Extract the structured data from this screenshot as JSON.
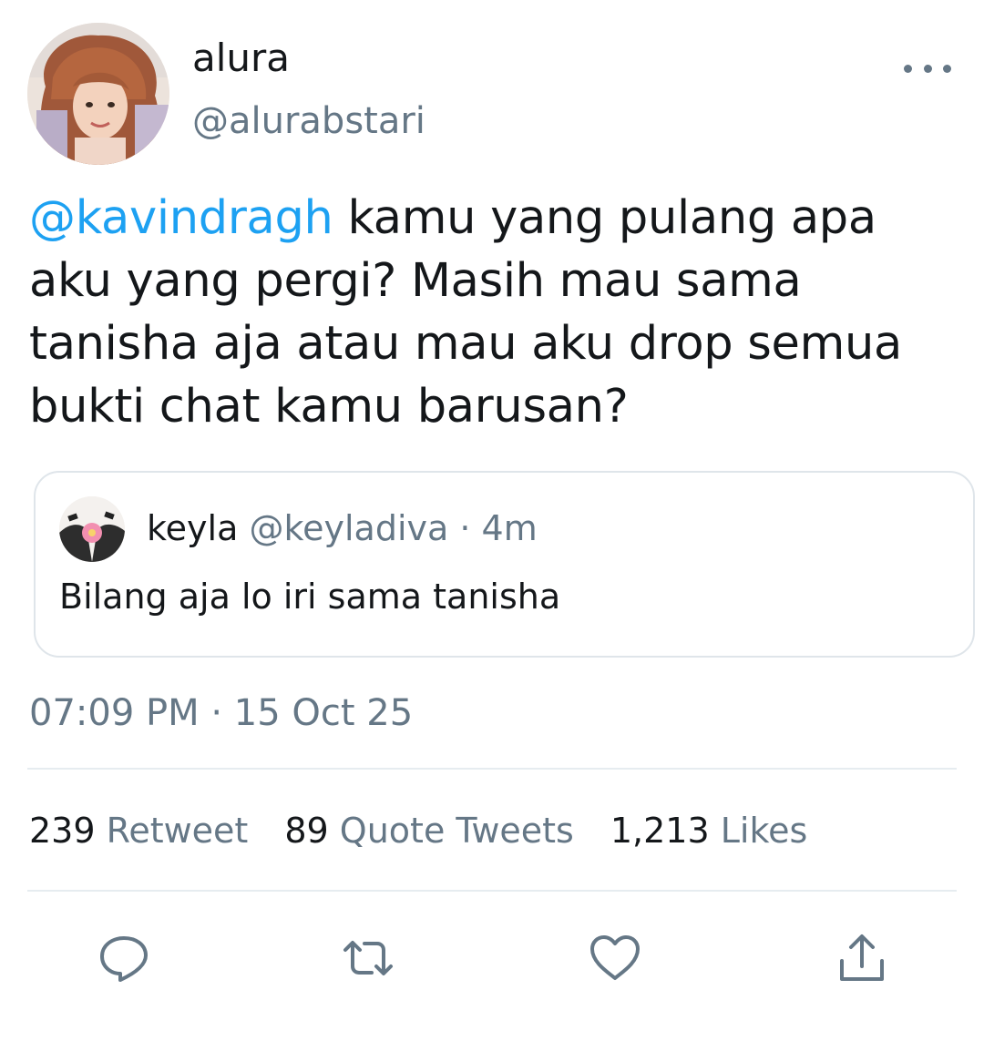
{
  "tweet": {
    "author": {
      "display_name": "alura",
      "handle": "@alurabstari"
    },
    "text": {
      "mention": "@kavindragh",
      "body": " kamu yang pulang apa aku yang pergi? Masih mau sama tanisha aja atau mau aku drop semua bukti chat kamu barusan?"
    },
    "quoted": {
      "display_name": "keyla",
      "handle_meta": "@keyladiva · 4m",
      "text": "Bilang aja lo iri sama tanisha"
    },
    "timestamp": "07:09 PM · 15 Oct 25",
    "stats": [
      {
        "count": "239",
        "label": "Retweet"
      },
      {
        "count": "89",
        "label": "Quote Tweets"
      },
      {
        "count": "1,213",
        "label": "Likes"
      }
    ]
  },
  "icons": {
    "more": "more-horizontal-icon",
    "reply": "reply-icon",
    "retweet": "retweet-icon",
    "like": "heart-icon",
    "share": "share-icon"
  },
  "colors": {
    "accent": "#1da1f2",
    "secondary_text": "#657786",
    "primary_text": "#14171a",
    "divider": "#e6ecf0"
  }
}
